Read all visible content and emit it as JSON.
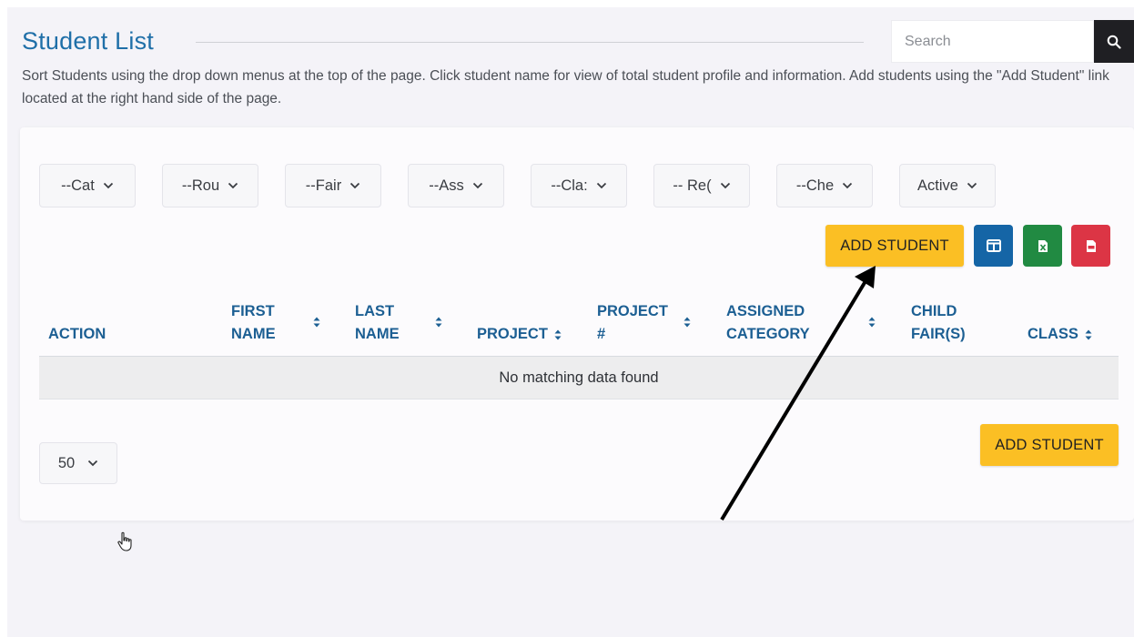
{
  "page": {
    "title": "Student List",
    "description": "Sort Students using the drop down menus at the top of the page. Click student name for view of total student profile and information. Add students using the \"Add Student\" link located at the right hand side of the page."
  },
  "search": {
    "placeholder": "Search",
    "icon": "search-icon"
  },
  "filters": [
    {
      "label": "--Cat"
    },
    {
      "label": "--Rou"
    },
    {
      "label": "--Fair"
    },
    {
      "label": "--Ass"
    },
    {
      "label": "--Cla:"
    },
    {
      "label": "-- Re("
    },
    {
      "label": "--Che"
    },
    {
      "label": "Active"
    }
  ],
  "toolbar": {
    "add_student_label": "ADD STUDENT",
    "columns_icon": "columns-icon",
    "excel_icon": "excel-export-icon",
    "pdf_icon": "pdf-export-icon",
    "colors": {
      "add": "#fbbf24",
      "columns": "#1565a6",
      "excel": "#218a42",
      "pdf": "#dc3545"
    }
  },
  "table": {
    "columns": [
      {
        "line1": "ACTION",
        "line2": ""
      },
      {
        "line1": "FIRST",
        "line2": "NAME"
      },
      {
        "line1": "LAST",
        "line2": "NAME"
      },
      {
        "line1": "PROJECT",
        "line2": ""
      },
      {
        "line1": "PROJECT",
        "line2": "#"
      },
      {
        "line1": "ASSIGNED",
        "line2": "CATEGORY"
      },
      {
        "line1": "CHILD",
        "line2": "FAIR(S)"
      },
      {
        "line1": "CLASS",
        "line2": ""
      }
    ],
    "empty_message": "No matching data found"
  },
  "footer": {
    "page_size": "50",
    "add_student_label": "ADD STUDENT"
  },
  "colors": {
    "title": "#1f6fa8",
    "header_text": "#1c5f93"
  }
}
